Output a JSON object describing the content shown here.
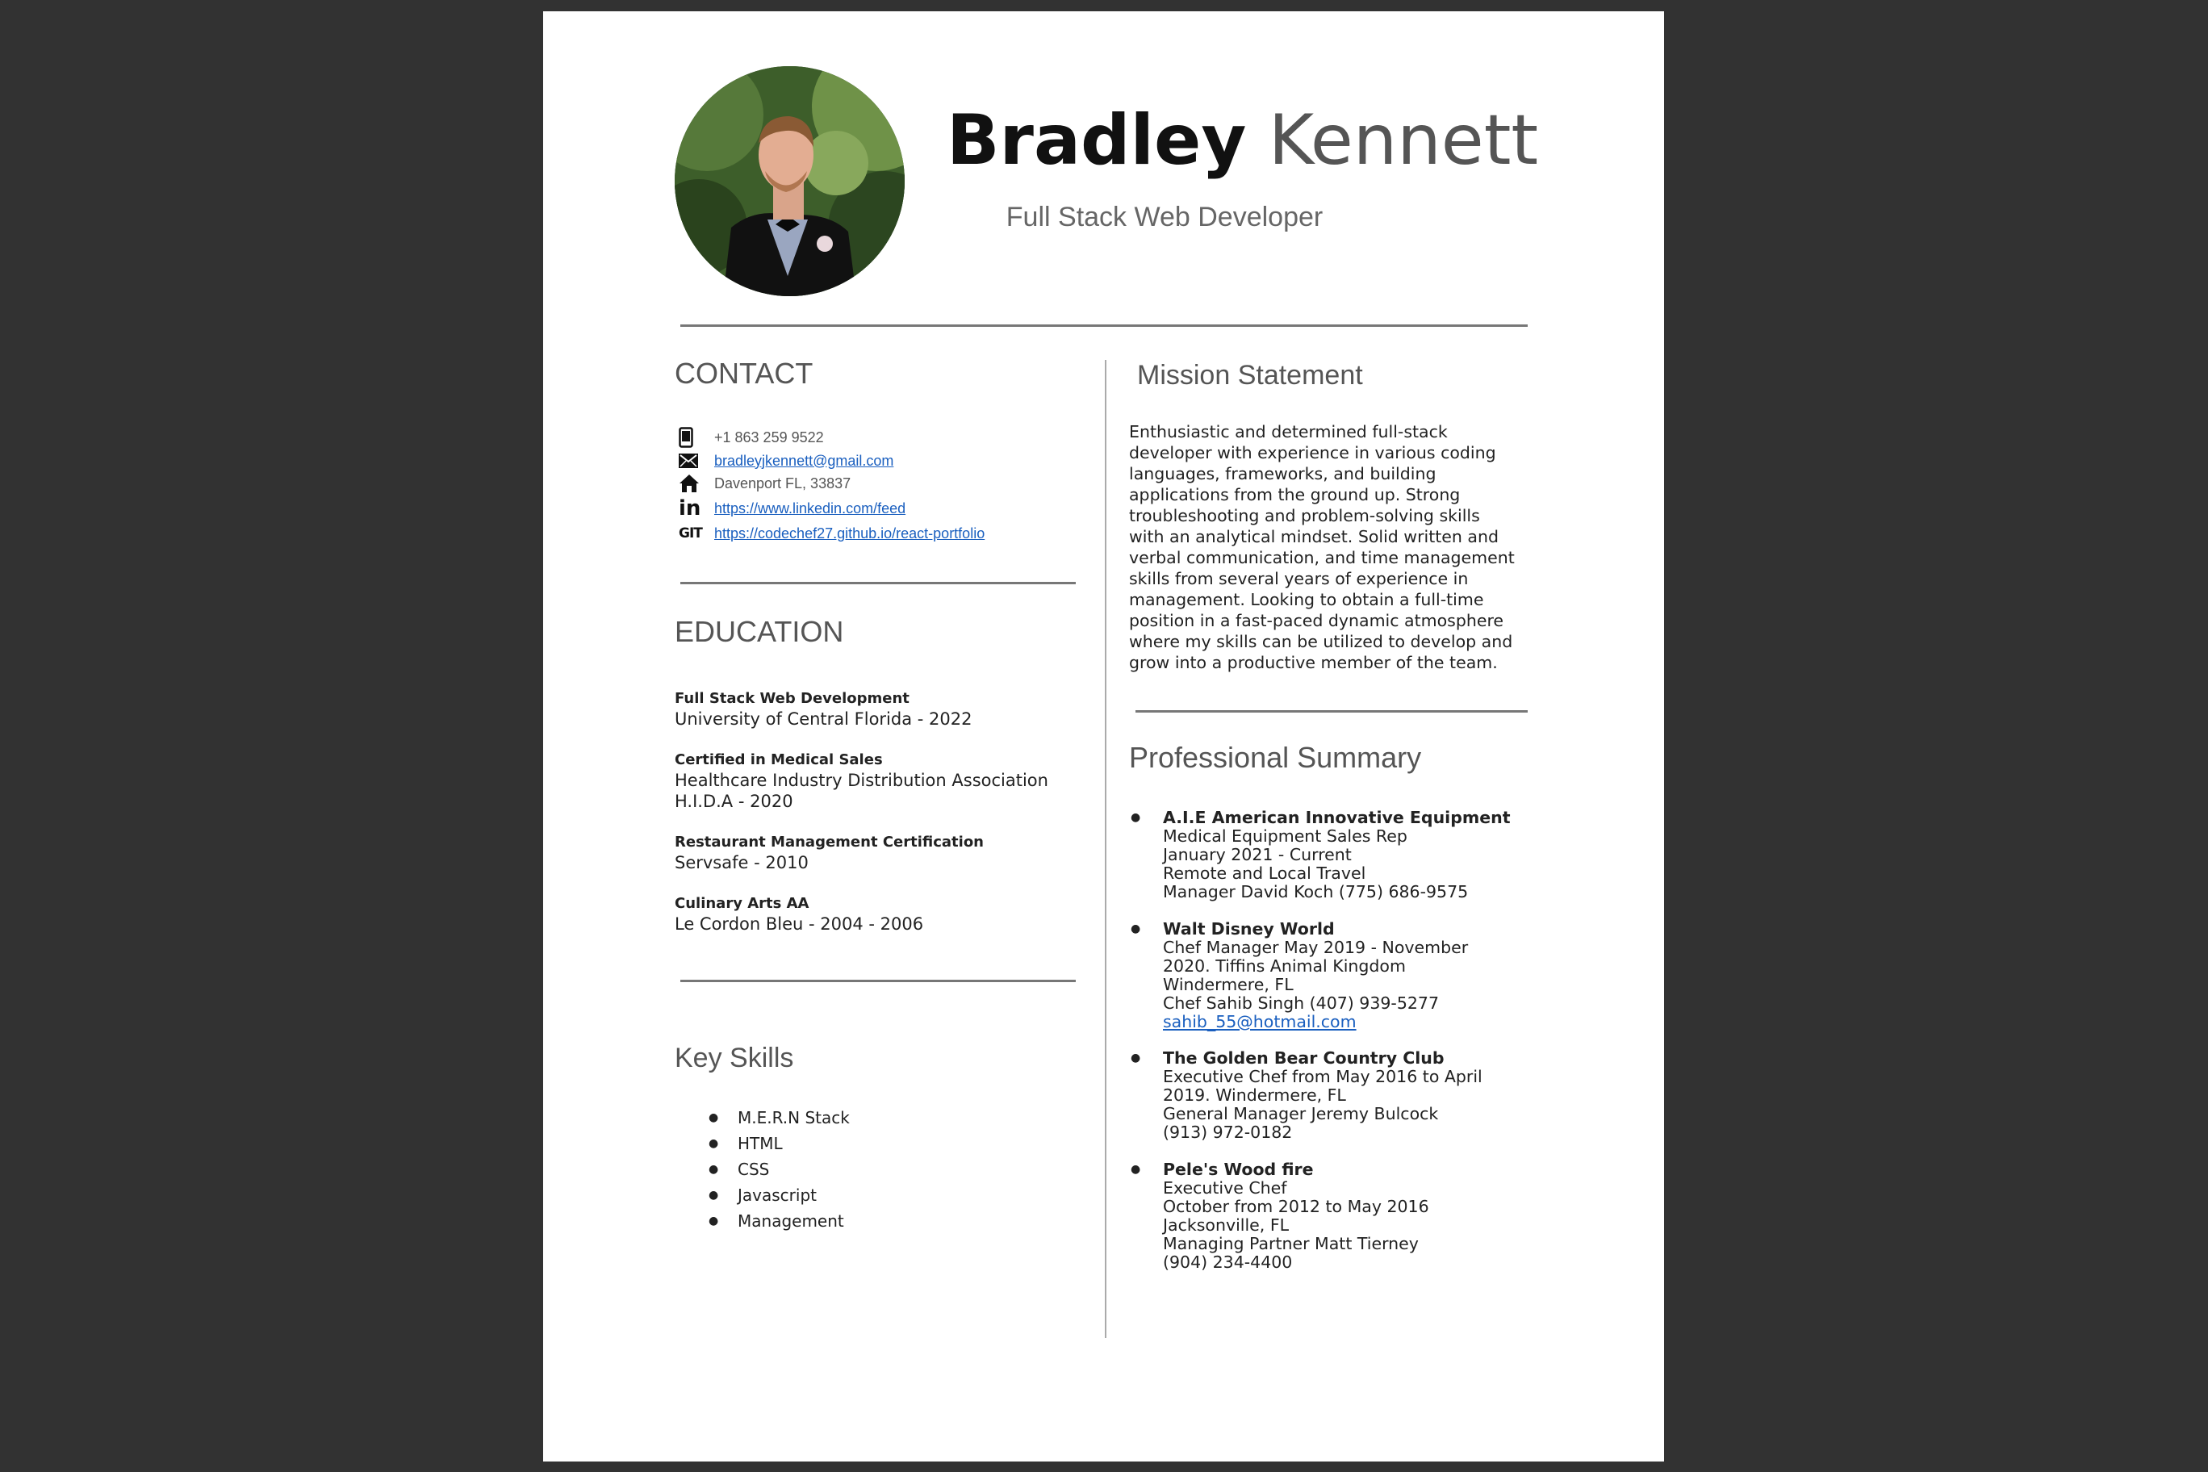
{
  "header": {
    "first_name": "Bradley",
    "last_name": "Kennett",
    "title": "Full Stack Web Developer"
  },
  "contact": {
    "heading": "CONTACT",
    "items": [
      {
        "icon": "phone-icon",
        "text": "+1 863 259 9522",
        "is_link": false
      },
      {
        "icon": "email-icon",
        "text": "bradleyjkennett@gmail.com",
        "is_link": true
      },
      {
        "icon": "home-icon",
        "text": "Davenport FL, 33837",
        "is_link": false
      },
      {
        "icon": "linkedin-icon",
        "text": "https://www.linkedin.com/feed",
        "is_link": true
      },
      {
        "icon": "git-icon",
        "text": "https://codechef27.github.io/react-portfolio",
        "is_link": true
      }
    ]
  },
  "education": {
    "heading": "EDUCATION",
    "entries": [
      {
        "title": "Full Stack Web Development",
        "lines": [
          "University of Central Florida - 2022"
        ]
      },
      {
        "title": "Certified in Medical Sales",
        "lines": [
          "Healthcare Industry Distribution Association",
          "H.I.D.A - 2020"
        ]
      },
      {
        "title": "Restaurant Management Certification",
        "lines": [
          "Servsafe - 2010"
        ]
      },
      {
        "title": "Culinary Arts AA",
        "lines": [
          "Le Cordon Bleu - 2004 - 2006"
        ]
      }
    ]
  },
  "skills": {
    "heading": "Key Skills",
    "items": [
      "M.E.R.N Stack",
      "HTML",
      "CSS",
      "Javascript",
      "Management"
    ]
  },
  "mission": {
    "heading": "Mission Statement",
    "lines": [
      "Enthusiastic and determined full-stack",
      "developer with experience in various coding",
      "languages, frameworks, and building",
      "applications from the ground up. Strong",
      "troubleshooting and problem-solving skills",
      "with an analytical mindset. Solid written and",
      "verbal communication, and time management",
      "skills from several years of experience in",
      "management. Looking to obtain a full-time",
      "position in a fast-paced dynamic atmosphere",
      "where my skills can be utilized to develop and",
      "grow into a productive member of the team."
    ]
  },
  "summary": {
    "heading": "Professional Summary",
    "jobs": [
      {
        "company": "A.I.E American Innovative Equipment",
        "lines": [
          "Medical Equipment Sales Rep",
          "January 2021 - Current",
          "Remote and Local Travel",
          "Manager David Koch (775) 686-9575"
        ]
      },
      {
        "company": "Walt Disney World",
        "lines": [
          "Chef Manager May 2019 - November",
          "2020. Tiffins Animal Kingdom",
          "Windermere, FL",
          "Chef Sahib Singh (407) 939-5277"
        ],
        "link": "sahib_55@hotmail.com"
      },
      {
        "company": "The Golden Bear Country Club",
        "lines": [
          "Executive Chef from May 2016 to April",
          "2019. Windermere, FL",
          "General Manager Jeremy Bulcock",
          "(913) 972-0182"
        ]
      },
      {
        "company": "Pele's Wood fire",
        "lines": [
          "Executive Chef",
          "October from 2012 to May 2016",
          "Jacksonville, FL",
          "Managing Partner Matt Tierney",
          "(904) 234-4400"
        ]
      }
    ]
  }
}
